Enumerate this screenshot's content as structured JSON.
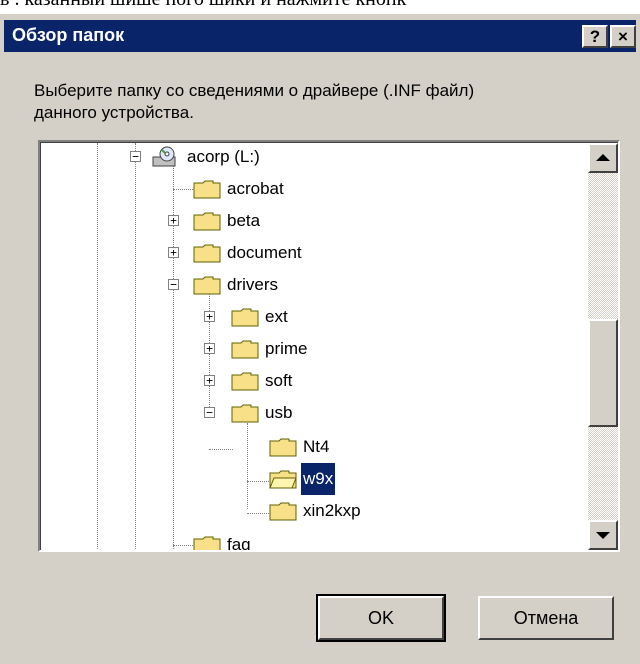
{
  "background_text": "в . казанный шише пого шики и нажмите кнопк",
  "dialog": {
    "title": "Обзор папок",
    "help_button": "?",
    "close_button": "×",
    "prompt": "Выберите папку со сведениями о драйвере (.INF файл)\nданного устройства.",
    "ok_label": "OK",
    "cancel_label": "Отмена"
  },
  "tree": {
    "items": [
      {
        "label": "acorp (L:)",
        "icon": "cd-drive-icon",
        "expander": "−"
      },
      {
        "label": "acrobat",
        "icon": "folder-icon",
        "expander": ""
      },
      {
        "label": "beta",
        "icon": "folder-icon",
        "expander": "+"
      },
      {
        "label": "document",
        "icon": "folder-icon",
        "expander": "+"
      },
      {
        "label": "drivers",
        "icon": "folder-open-icon",
        "expander": "−"
      },
      {
        "label": "ext",
        "icon": "folder-icon",
        "expander": "+"
      },
      {
        "label": "prime",
        "icon": "folder-icon",
        "expander": "+"
      },
      {
        "label": "soft",
        "icon": "folder-icon",
        "expander": "+"
      },
      {
        "label": "usb",
        "icon": "folder-open-icon",
        "expander": "−"
      },
      {
        "label": "Nt4",
        "icon": "folder-icon",
        "expander": ""
      },
      {
        "label": "w9x",
        "icon": "folder-open-icon",
        "expander": "",
        "selected": true
      },
      {
        "label": "xin2kxp",
        "icon": "folder-icon",
        "expander": ""
      },
      {
        "label": "faq",
        "icon": "folder-icon",
        "expander": ""
      }
    ]
  },
  "colors": {
    "title_bar": "#0a246a",
    "dialog_face": "#d4d0c8",
    "selection": "#0a246a"
  }
}
